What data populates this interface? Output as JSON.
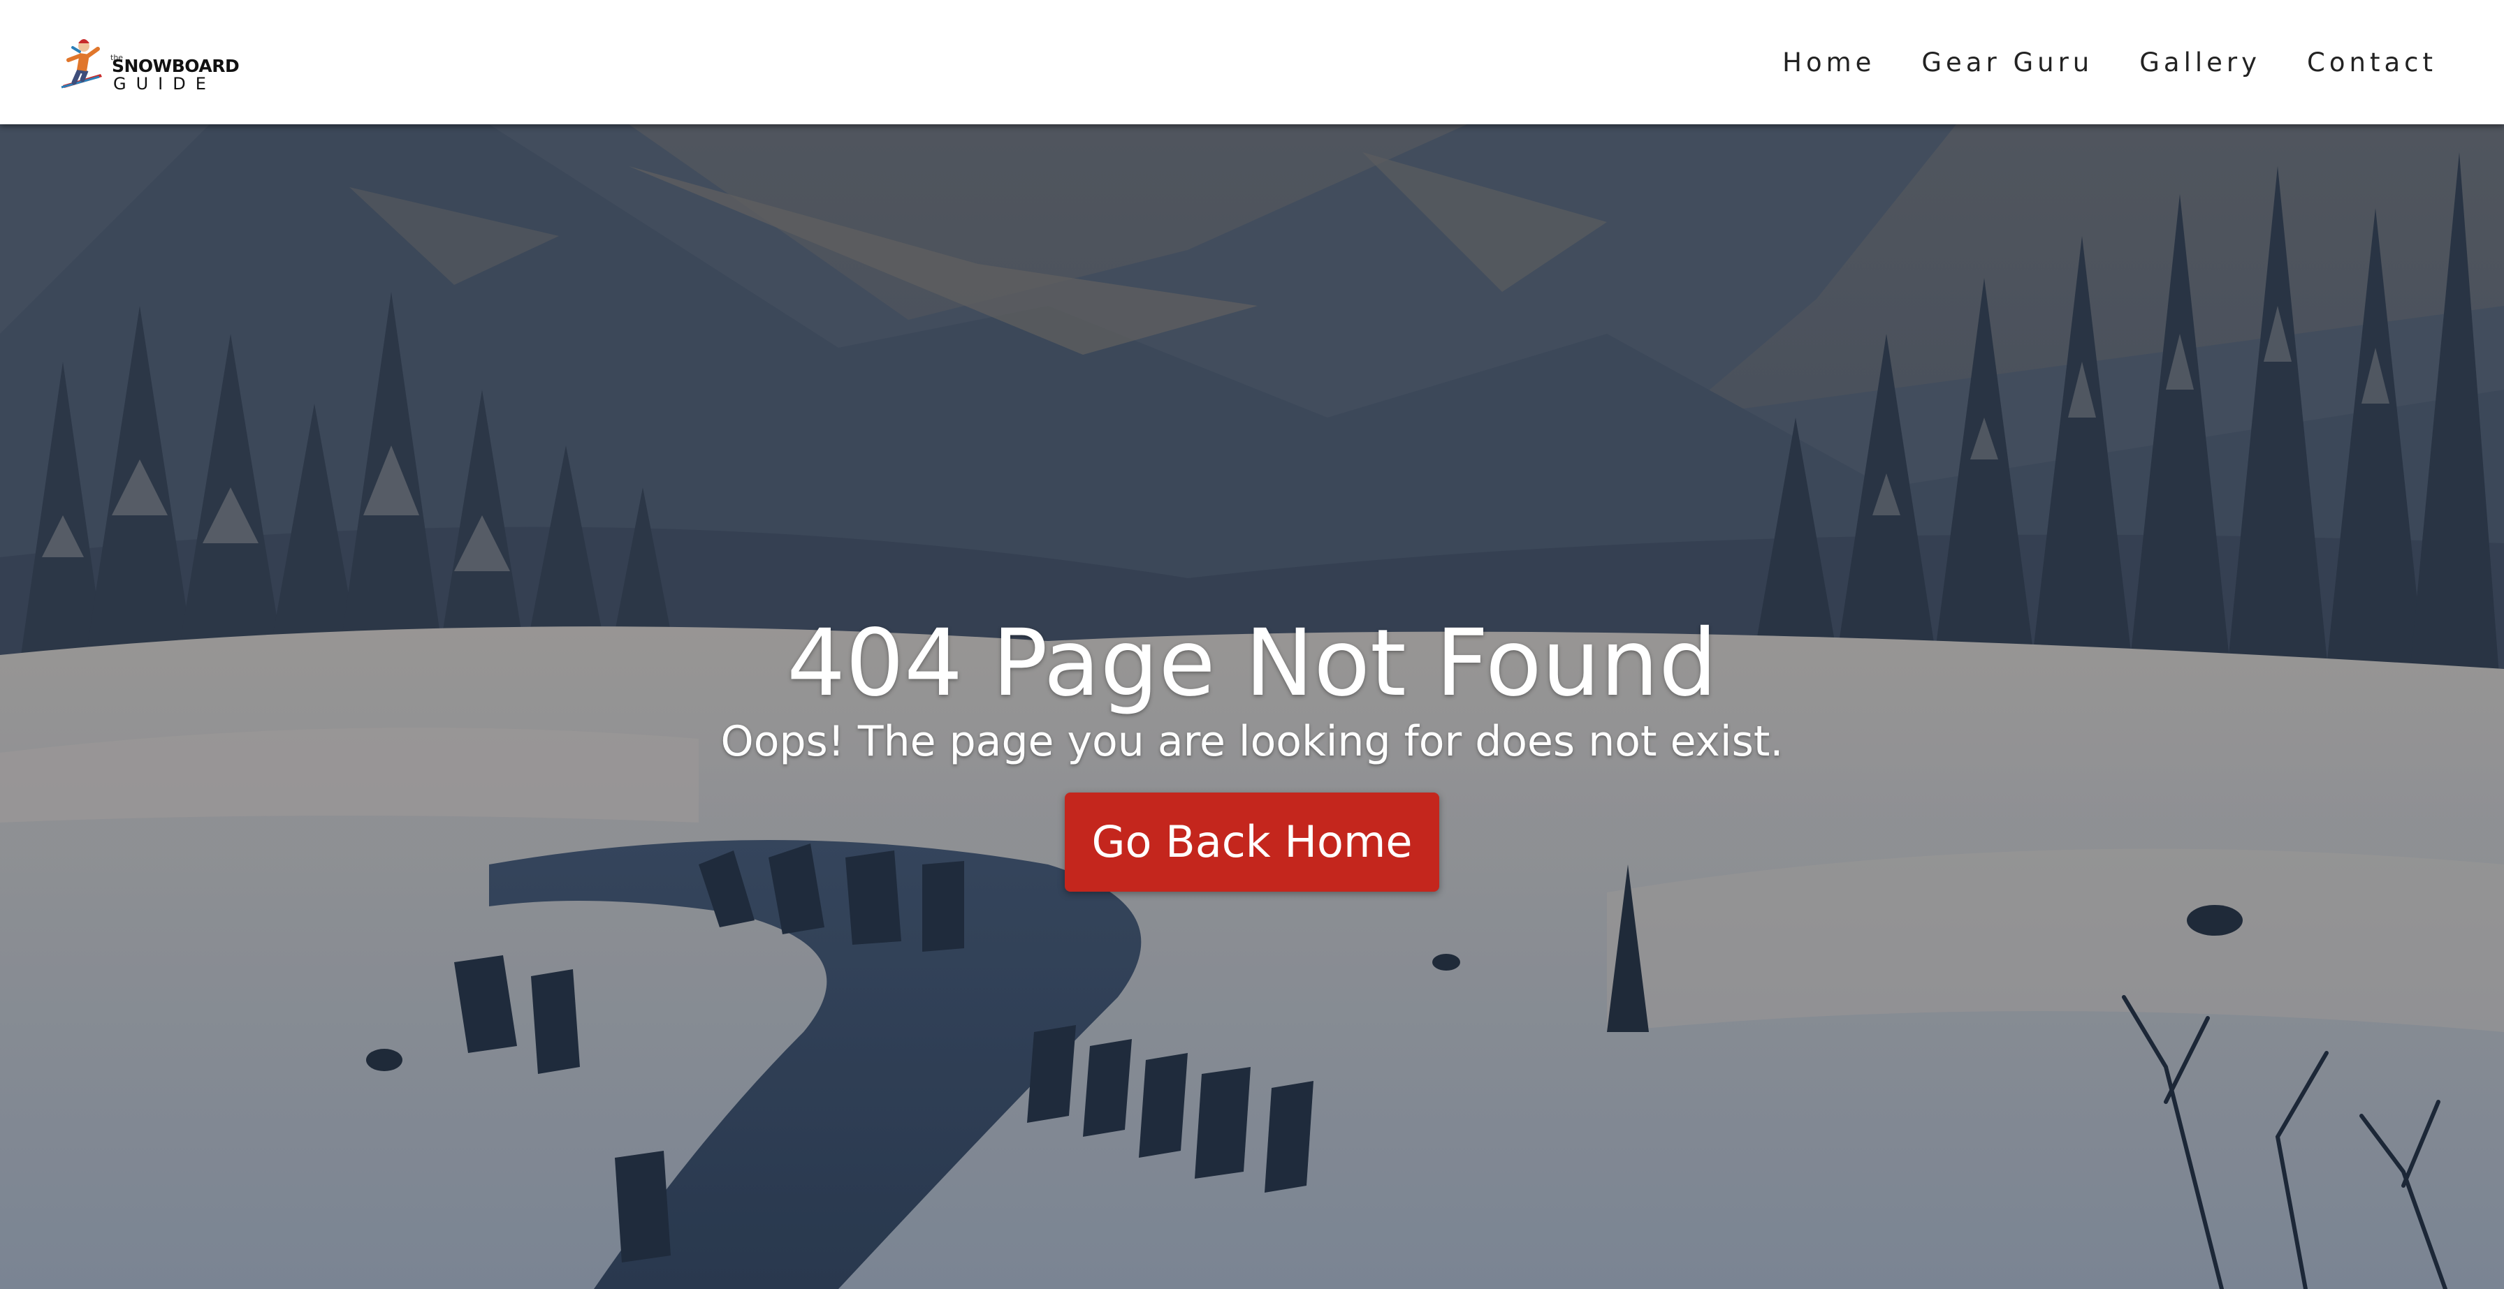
{
  "logo": {
    "small_text": "the",
    "line1": "SNOWBOARD",
    "line2": "GUIDE"
  },
  "nav": {
    "items": [
      {
        "label": "Home"
      },
      {
        "label": "Gear Guru"
      },
      {
        "label": "Gallery"
      },
      {
        "label": "Contact"
      }
    ]
  },
  "hero": {
    "title": "404 Page Not Found",
    "subtitle": "Oops! The page you are looking for does not exist.",
    "button_label": "Go Back Home",
    "icon": "snowboarder-logo-icon"
  },
  "colors": {
    "button": "#c4261d",
    "navbar": "#ffffff",
    "sky": "#3b4657",
    "snow": "#a9a7a4"
  }
}
